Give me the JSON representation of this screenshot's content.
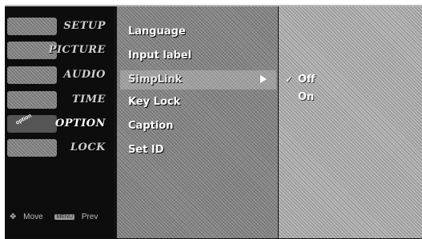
{
  "nav": {
    "items": [
      {
        "label": "SETUP"
      },
      {
        "label": "PICTURE"
      },
      {
        "label": "AUDIO"
      },
      {
        "label": "TIME"
      },
      {
        "label": "OPTION"
      },
      {
        "label": "LOCK"
      }
    ],
    "active": "OPTION",
    "option_badge": "option"
  },
  "menu": {
    "items": [
      {
        "label": "Language"
      },
      {
        "label": "Input label"
      },
      {
        "label": "SimpLink"
      },
      {
        "label": "Key Lock"
      },
      {
        "label": "Caption"
      },
      {
        "label": "Set ID"
      }
    ],
    "active": "SimpLink"
  },
  "submenu": {
    "items": [
      {
        "label": "Off",
        "selected": true
      },
      {
        "label": "On",
        "selected": false
      }
    ]
  },
  "footer": {
    "move_label": "Move",
    "prev_key": "MENU",
    "prev_label": "Prev"
  }
}
